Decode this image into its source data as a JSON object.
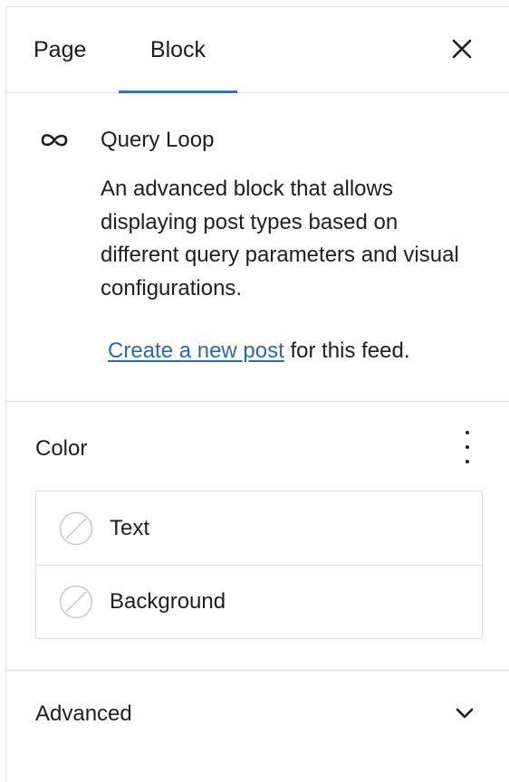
{
  "tabs": {
    "page_label": "Page",
    "block_label": "Block",
    "active": "Block"
  },
  "block_card": {
    "icon": "loop-icon",
    "title": "Query Loop",
    "description": "An advanced block that allows displaying post types based on different query parameters and visual configurations.",
    "feed_link_text": "Create a new post",
    "feed_suffix": " for this feed."
  },
  "color_section": {
    "title": "Color",
    "items": [
      {
        "label": "Text",
        "swatch": "empty"
      },
      {
        "label": "Background",
        "swatch": "empty"
      }
    ]
  },
  "advanced": {
    "title": "Advanced"
  },
  "colors": {
    "accent": "#3a73a8",
    "link": "#2b6aa6",
    "text": "#1e1e1e",
    "border": "#e0e0e0"
  }
}
